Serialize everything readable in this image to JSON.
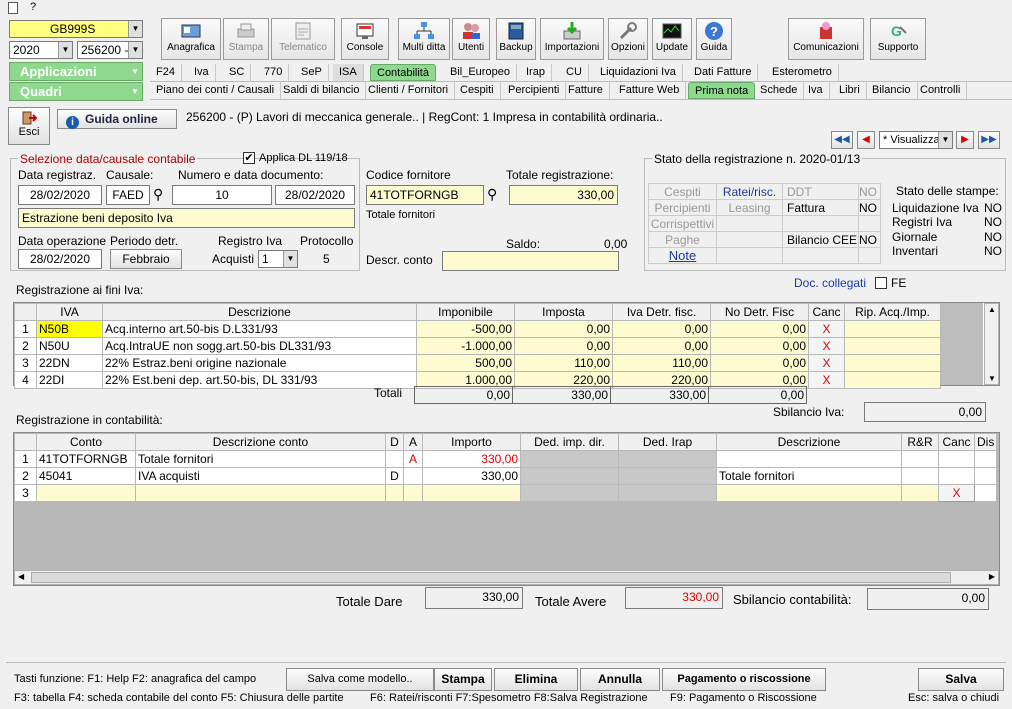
{
  "titlebar": {
    "text": "?"
  },
  "left": {
    "company": "GB999S",
    "year": "2020",
    "ditta": "256200 -",
    "applicazioni": "Applicazioni",
    "quadri": "Quadri"
  },
  "toolbar": [
    {
      "label": "Anagrafica",
      "icon": "anagrafica-icon",
      "enabled": true
    },
    {
      "label": "Stampa",
      "icon": "printer-icon",
      "enabled": false
    },
    {
      "label": "Telematico",
      "icon": "telematico-icon",
      "enabled": false
    },
    {
      "label": "Console",
      "icon": "console-icon",
      "enabled": true
    },
    {
      "label": "Multi ditta",
      "icon": "network-icon",
      "enabled": true
    },
    {
      "label": "Utenti",
      "icon": "users-icon",
      "enabled": true
    },
    {
      "label": "Backup",
      "icon": "backup-icon",
      "enabled": true
    },
    {
      "label": "Importazioni",
      "icon": "import-icon",
      "enabled": true
    },
    {
      "label": "Opzioni",
      "icon": "wrench-icon",
      "enabled": true
    },
    {
      "label": "Update",
      "icon": "update-icon",
      "enabled": true
    },
    {
      "label": "Guida",
      "icon": "help-icon",
      "enabled": true
    },
    {
      "label": "Comunicazioni",
      "icon": "comunicazioni-icon",
      "enabled": true
    },
    {
      "label": "Supporto",
      "icon": "supporto-icon",
      "enabled": true
    }
  ],
  "tabs1": [
    "F24",
    "Iva",
    "SC",
    "770",
    "SeP",
    "ISA",
    "Contabilità",
    "Bil_Europeo",
    "Irap",
    "CU",
    "Liquidazioni Iva",
    "Dati Fatture",
    "Esterometro"
  ],
  "tabs2": [
    "Piano dei conti / Causali",
    "Saldi di bilancio",
    "Clienti / Fornitori",
    "Cespiti",
    "Percipienti",
    "Fatture",
    "Fatture Web",
    "Prima nota",
    "Schede",
    "Iva",
    "Libri",
    "Bilancio",
    "Controlli"
  ],
  "header": {
    "esci": "Esci",
    "guida": "Guida online",
    "title": "256200 - (P) Lavori di meccanica generale.. | RegCont: 1 Impresa  in contabilità ordinaria..",
    "nav_mode": "* Visualizza"
  },
  "selezione": {
    "title": "Selezione data/causale contabile",
    "applica": "Applica DL 119/18",
    "data_reg_label": "Data registraz.",
    "causale_label": "Causale:",
    "numdoc_label": "Numero e data documento:",
    "data_reg": "28/02/2020",
    "causale": "FAED",
    "numero": "10",
    "data_doc": "28/02/2020",
    "descrizione": "Estrazione beni deposito Iva",
    "data_op_label": "Data operazione",
    "periodo_label": "Periodo detr.",
    "registro_label": "Registro Iva",
    "protocollo_label": "Protocollo",
    "data_op": "28/02/2020",
    "periodo": "Febbraio",
    "acquisti_label": "Acquisti",
    "registro": "1",
    "protocollo": "5"
  },
  "fornitore": {
    "codice_label": "Codice fornitore",
    "totale_label": "Totale registrazione:",
    "codice": "41TOTFORNGB",
    "totale": "330,00",
    "nome": "Totale fornitori",
    "saldo_label": "Saldo:",
    "saldo": "0,00",
    "descr_label": "Descr. conto"
  },
  "stato": {
    "title": "Stato della registrazione n. 2020-01/13",
    "rows": [
      [
        "Cespiti",
        "Ratei/risc.",
        "DDT",
        "NO"
      ],
      [
        "Percipienti",
        "Leasing",
        "Fattura",
        "NO"
      ],
      [
        "Corrispettivi",
        "",
        "",
        ""
      ],
      [
        "Paghe",
        "",
        "Bilancio CEE",
        "NO"
      ],
      [
        "Note",
        "",
        "",
        ""
      ]
    ],
    "stampe_title": "Stato delle stampe:",
    "stampe": [
      [
        "Liquidazione Iva",
        "NO"
      ],
      [
        "Registri Iva",
        "NO"
      ],
      [
        "Giornale",
        "NO"
      ],
      [
        "Inventari",
        "NO"
      ]
    ]
  },
  "doc": {
    "label": "Doc. collegati",
    "fe": "FE"
  },
  "iva": {
    "title": "Registrazione ai fini Iva:",
    "headers": [
      "IVA",
      "Descrizione",
      "Imponibile",
      "Imposta",
      "Iva Detr. fisc.",
      "No Detr. Fisc",
      "Canc",
      "Rip. Acq./Imp."
    ],
    "rows": [
      [
        "1",
        "N50B",
        "Acq.interno art.50-bis D.L331/93",
        "-500,00",
        "0,00",
        "0,00",
        "0,00",
        "X"
      ],
      [
        "2",
        "N50U",
        "Acq.IntraUE non sogg.art.50-bis DL331/93",
        "-1.000,00",
        "0,00",
        "0,00",
        "0,00",
        "X"
      ],
      [
        "3",
        "22DN",
        "22% Estraz.beni origine nazionale",
        "500,00",
        "110,00",
        "110,00",
        "0,00",
        "X"
      ],
      [
        "4",
        "22DI",
        "22% Est.beni dep. art.50-bis, DL 331/93",
        "1.000,00",
        "220,00",
        "220,00",
        "0,00",
        "X"
      ]
    ],
    "totali_label": "Totali",
    "totali": [
      "0,00",
      "330,00",
      "330,00",
      "0,00"
    ],
    "sbilancio_label": "Sbilancio Iva:",
    "sbilancio": "0,00"
  },
  "cont": {
    "title": "Registrazione in contabilità:",
    "headers": [
      "Conto",
      "Descrizione conto",
      "D",
      "A",
      "Importo",
      "Ded. imp. dir.",
      "Ded. Irap",
      "Descrizione",
      "R&R",
      "Canc",
      "Dis"
    ],
    "rows": [
      [
        "1",
        "41TOTFORNGB",
        "Totale fornitori",
        "",
        "A",
        "330,00",
        "",
        "",
        "",
        "",
        ""
      ],
      [
        "2",
        "45041",
        "IVA acquisti",
        "D",
        "",
        "330,00",
        "",
        "",
        "Totale fornitori",
        "",
        ""
      ],
      [
        "3",
        "",
        "",
        "",
        "",
        "",
        "",
        "",
        "",
        "",
        "X"
      ]
    ],
    "tot_dare_label": "Totale Dare",
    "tot_dare": "330,00",
    "tot_avere_label": "Totale Avere",
    "tot_avere": "330,00",
    "sbil_label": "Sbilancio contabilità:",
    "sbil": "0,00"
  },
  "footer": {
    "tasti": "Tasti funzione: F1: Help  F2: anagrafica del campo",
    "salva_modello": "Salva come modello..",
    "stampa": "Stampa",
    "elimina": "Elimina",
    "annulla": "Annulla",
    "pagamento": "Pagamento o riscossione",
    "salva": "Salva",
    "line2a": "F3: tabella  F4: scheda contabile del conto  F5: Chiusura delle partite",
    "line2b": "F6: Ratei/risconti  F7:Spesometro  F8:Salva Registrazione",
    "line2c": "F9: Pagamento o Riscossione",
    "line2d": "Esc: salva o chiudi"
  },
  "colors": {
    "accent_green": "#8fd98f",
    "yellow_field": "#fffbd0",
    "red": "#e00000",
    "blue_link": "#0000cc"
  }
}
